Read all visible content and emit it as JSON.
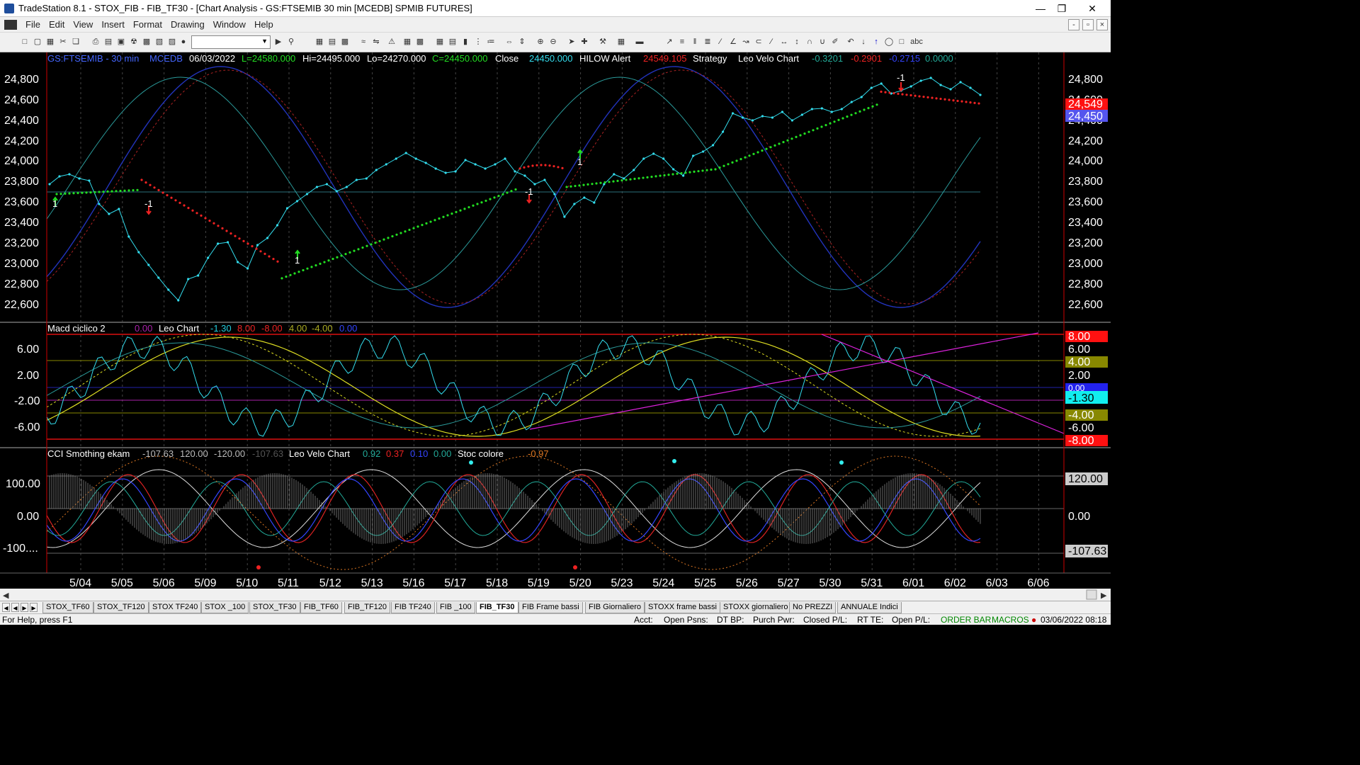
{
  "window": {
    "title": "TradeStation 8.1 - STOX_FIB - FIB_TF30 - [Chart Analysis - GS:FTSEMIB  30 min  [MCEDB] SPMIB FUTURES]",
    "controls": {
      "minimize": "—",
      "restore": "❐",
      "close": "✕"
    }
  },
  "menu": {
    "items": [
      "File",
      "Edit",
      "View",
      "Insert",
      "Format",
      "Drawing",
      "Window",
      "Help"
    ],
    "mdi": {
      "minimize": "-",
      "restore": "▫",
      "close": "×"
    }
  },
  "toolbar": {
    "combo_value": "",
    "text_tool": "abc",
    "icons": [
      "new-icon",
      "open-icon",
      "save-icon",
      "print-icon",
      "lock-icon",
      "data-window-icon",
      "zoom-in-icon",
      "zoom-out-icon",
      "pointer-icon",
      "trendline-icon",
      "fib-icon",
      "arrow-up-icon",
      "arrow-down-icon",
      "ellipse-icon",
      "rectangle-icon"
    ]
  },
  "chart": {
    "price_header": {
      "symbol": "GS:FTSEMIB - 30 min",
      "feed": "MCEDB",
      "date": "06/03/2022",
      "low_open": "L=24580.000",
      "hi": "Hi=24495.000",
      "lo": "Lo=24270.000",
      "close_val": "C=24450.000",
      "close_label": "Close",
      "close_num": "24450.000",
      "hilow_label": "HILOW Alert",
      "hilow_val": "24549.105",
      "strategy": "Strategy",
      "leo_velo": "Leo Velo Chart",
      "v1": "-0.3201",
      "v2": "-0.2901",
      "v3": "-0.2715",
      "v4": "0.0000"
    },
    "macd_header": {
      "name": "Macd ciclico 2",
      "v0": "0.00",
      "leo": "Leo Chart",
      "v1": "-1.30",
      "v2": "8.00",
      "v3": "-8.00",
      "v4": "4.00",
      "v5": "-4.00",
      "v6": "0.00"
    },
    "cci_header": {
      "name": "CCI Smothing ekam",
      "v1": "-107.63",
      "v2": "120.00",
      "v3": "-120.00",
      "v4": "-107.63",
      "leo": "Leo Velo Chart",
      "l1": "0.92",
      "l2": "0.37",
      "l3": "0.10",
      "l4": "0.00",
      "stoc": "Stoc colore",
      "stoc_val": "-0.97"
    },
    "price_axis": [
      "24,800",
      "24,600",
      "24,400",
      "24,200",
      "24,000",
      "23,800",
      "23,600",
      "23,400",
      "23,200",
      "23,000",
      "22,800",
      "22,600"
    ],
    "price_badges": {
      "red": "24,549",
      "blue": "24,450"
    },
    "macd_axis": [
      "6.00",
      "2.00",
      "-2.00",
      "-6.00"
    ],
    "macd_badges": [
      "8.00",
      "6.00",
      "4.00",
      "2.00",
      "0.00",
      "-1.30",
      "-4.00",
      "-6.00",
      "-8.00"
    ],
    "cci_axis": [
      "100.00",
      "0.00",
      "-100...."
    ],
    "cci_badges": {
      "top": "120.00",
      "mid": "0.00",
      "low": "-107.63"
    },
    "signal_labels": [
      "1",
      "-1",
      "1",
      "-1",
      "1",
      "-1"
    ],
    "dates": [
      "5/04",
      "5/05",
      "5/06",
      "5/09",
      "5/10",
      "5/11",
      "5/12",
      "5/13",
      "5/16",
      "5/17",
      "5/18",
      "5/19",
      "5/20",
      "5/23",
      "5/24",
      "5/25",
      "5/26",
      "5/27",
      "5/30",
      "5/31",
      "6/01",
      "6/02",
      "6/03",
      "6/06"
    ],
    "colors": {
      "up": "#22cc22",
      "down": "#ee2222",
      "price": "#33ddee",
      "axis_text": "#ffffff"
    }
  },
  "tabs": {
    "items": [
      "STOX_TF60",
      "STOX_TF120",
      "STOX TF240",
      "STOX _100",
      "STOX_TF30",
      "FIB_TF60",
      "FIB_TF120",
      "FIB TF240",
      "FIB _100",
      "FIB_TF30",
      "FIB Frame bassi",
      "FIB Giornaliero",
      "STOXX frame bassi",
      "STOXX giornaliero",
      "No PREZZI",
      "ANNUALE Indici"
    ],
    "active": "FIB_TF30"
  },
  "status": {
    "help": "For Help, press F1",
    "acct": "Acct:",
    "open_psns": "Open Psns:",
    "dt_bp": "DT BP:",
    "purch_pwr": "Purch Pwr:",
    "closed_pl": "Closed P/L:",
    "rt_te": "RT TE:",
    "open_pl": "Open P/L:",
    "order_bar": "ORDER BAR",
    "macros": "MACROS",
    "datetime": "03/06/2022 08:18"
  }
}
